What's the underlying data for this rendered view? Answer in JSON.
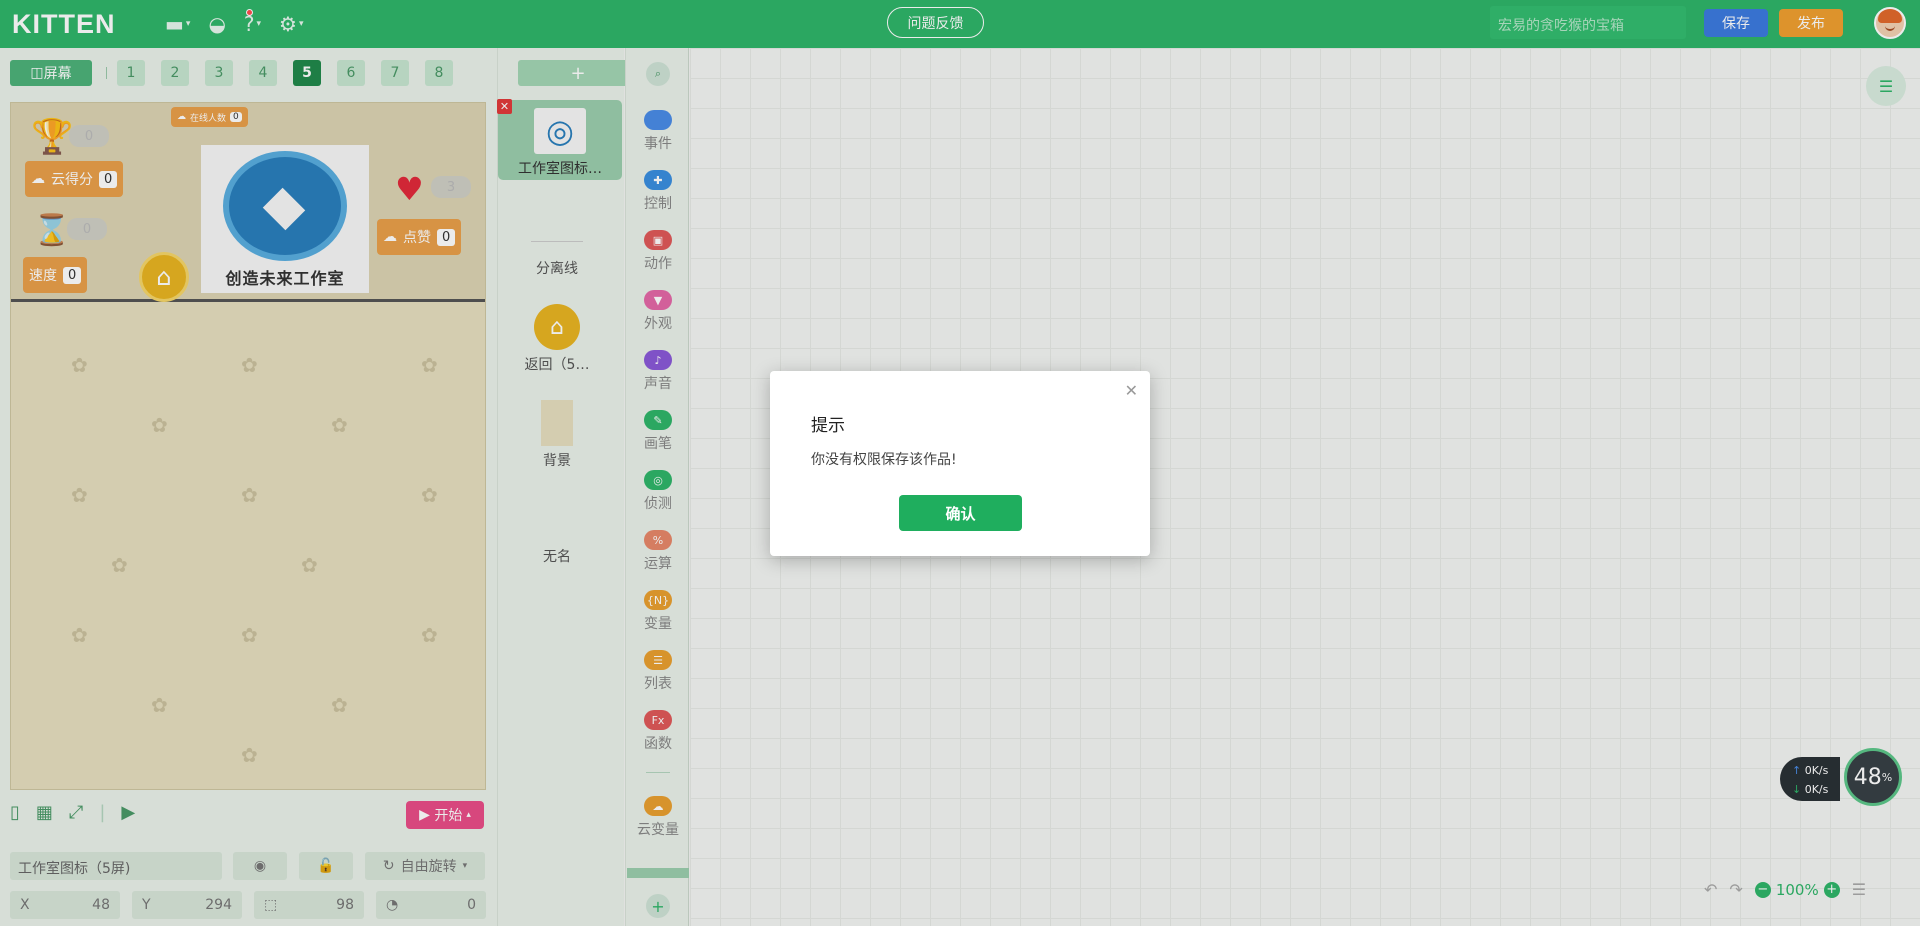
{
  "header": {
    "logo": "KITTEN",
    "feedback": "问题反馈",
    "project_name": "宏易的贪吃猴的宝箱",
    "save": "保存",
    "publish": "发布"
  },
  "stage_bar": {
    "screen_label": "屏幕",
    "screens": [
      "1",
      "2",
      "3",
      "4",
      "5",
      "6",
      "7",
      "8"
    ],
    "active_screen": "5"
  },
  "stage": {
    "online_label": "在线人数",
    "online_value": "0",
    "trophy_value": "0",
    "cloud_score_label": "云得分",
    "cloud_score_value": "0",
    "timer_value": "0",
    "speed_label": "速度",
    "speed_value": "0",
    "heart_value": "3",
    "like_label": "点赞",
    "like_value": "0",
    "logo_caption": "创造未来工作室"
  },
  "stage_footer": {
    "start": "开始"
  },
  "properties": {
    "name": "工作室图标（5屏)",
    "rotation": "自由旋转",
    "x_label": "X",
    "x_value": "48",
    "y_label": "Y",
    "y_value": "294",
    "size_value": "98",
    "angle_value": "0"
  },
  "sprites": {
    "add": "+",
    "items": [
      {
        "label": "工作室图标…"
      },
      {
        "label": "分离线"
      },
      {
        "label": "返回（5…"
      },
      {
        "label": "背景"
      },
      {
        "label": "无名"
      }
    ]
  },
  "categories": [
    {
      "label": "事件",
      "color": "#4a8de8"
    },
    {
      "label": "控制",
      "color": "#3a8fe0"
    },
    {
      "label": "动作",
      "color": "#e05a5a"
    },
    {
      "label": "外观",
      "color": "#e469a8"
    },
    {
      "label": "声音",
      "color": "#8a5ad8"
    },
    {
      "label": "画笔",
      "color": "#2fb66a"
    },
    {
      "label": "侦测",
      "color": "#2fb66a"
    },
    {
      "label": "运算",
      "color": "#e8886a"
    },
    {
      "label": "变量",
      "color": "#eaa030"
    },
    {
      "label": "列表",
      "color": "#eaa030"
    },
    {
      "label": "函数",
      "color": "#e05a5a"
    },
    {
      "label": "云变量",
      "color": "#eaa030"
    }
  ],
  "dialog": {
    "title": "提示",
    "message": "你没有权限保存该作品!",
    "confirm": "确认"
  },
  "network": {
    "up": "0K/s",
    "down": "0K/s",
    "percent": "48"
  },
  "zoom": "100%"
}
